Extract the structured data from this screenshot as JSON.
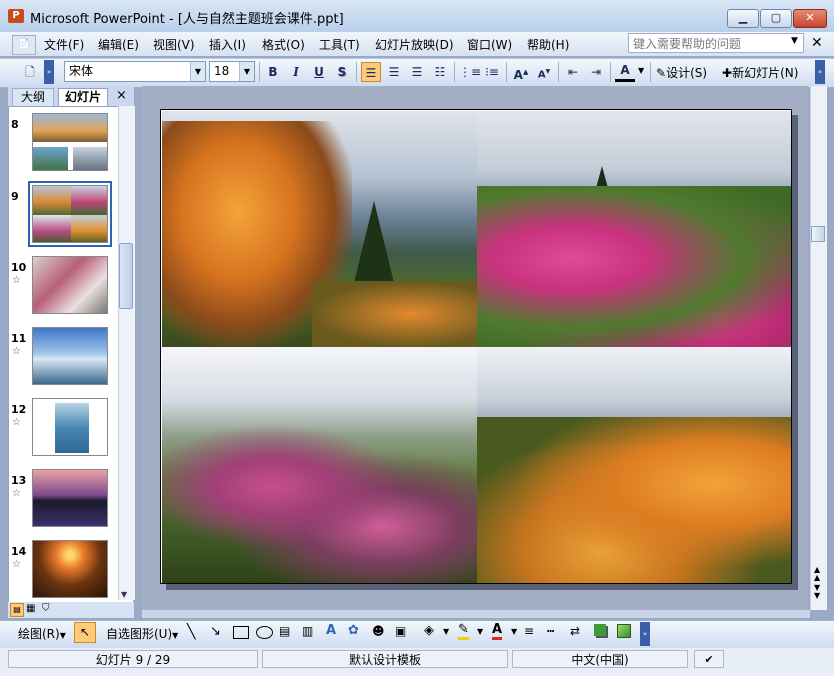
{
  "window": {
    "title": "Microsoft PowerPoint - [人与自然主题班会课件.ppt]",
    "app_icon": "powerpoint-icon",
    "controls": [
      "minimize",
      "maximize",
      "close"
    ]
  },
  "menu": {
    "items": [
      {
        "label": "文件(F)"
      },
      {
        "label": "编辑(E)"
      },
      {
        "label": "视图(V)"
      },
      {
        "label": "插入(I)"
      },
      {
        "label": "格式(O)"
      },
      {
        "label": "工具(T)"
      },
      {
        "label": "幻灯片放映(D)"
      },
      {
        "label": "窗口(W)"
      },
      {
        "label": "帮助(H)"
      }
    ],
    "help_placeholder": "键入需要帮助的问题"
  },
  "format_toolbar": {
    "font_name": "宋体",
    "font_size": "18",
    "bold": "B",
    "italic": "I",
    "underline": "U",
    "shadow": "S",
    "design_label": "设计(S)",
    "new_slide_label": "新幻灯片(N)"
  },
  "left_pane": {
    "tab_outline": "大纲",
    "tab_slides": "幻灯片",
    "close": "×",
    "slides": [
      {
        "number": "8",
        "star": ""
      },
      {
        "number": "9",
        "star": ""
      },
      {
        "number": "10",
        "star": "☆"
      },
      {
        "number": "11",
        "star": "☆"
      },
      {
        "number": "12",
        "star": "☆"
      },
      {
        "number": "13",
        "star": "☆"
      },
      {
        "number": "14",
        "star": "☆"
      }
    ],
    "selected_slide": "9"
  },
  "draw_toolbar": {
    "draw_label": "绘图(R)",
    "autoshapes_label": "自选图形(U)"
  },
  "status": {
    "slide_position": "幻灯片 9 / 29",
    "template": "默认设计模板",
    "language": "中文(中国)"
  },
  "colors": {
    "accent": "#2e64b8",
    "toolbar_highlight": "#ffc97a",
    "close_button": "#c4452f"
  }
}
